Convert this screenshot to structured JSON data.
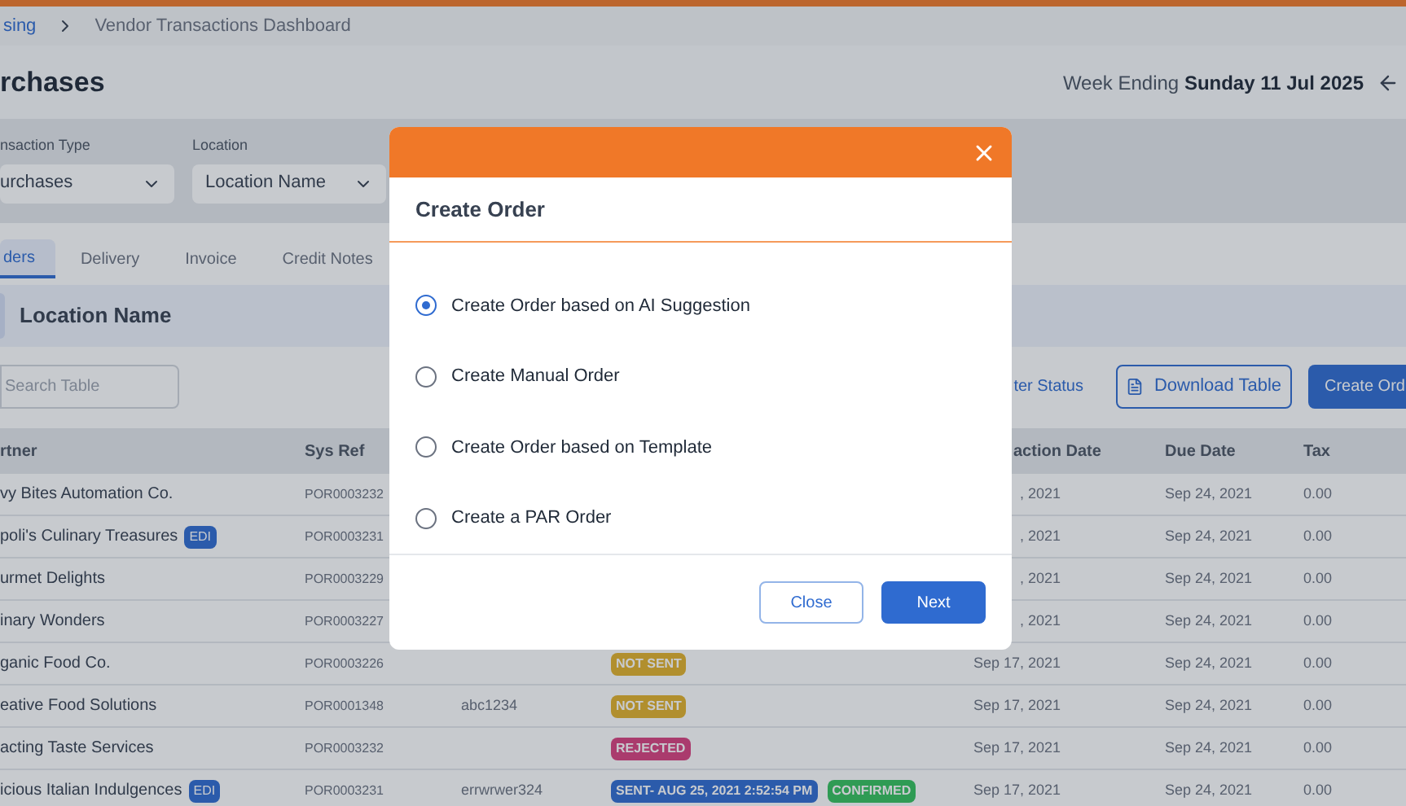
{
  "breadcrumb": [
    {
      "label": "sing",
      "link": true
    },
    {
      "label": "Vendor Transactions Dashboard",
      "link": false
    }
  ],
  "page_title": "rchases",
  "week": {
    "label": "Week Ending",
    "value": "Sunday 11 Jul 2025"
  },
  "filters": [
    {
      "label": "nsaction Type",
      "value": "urchases"
    },
    {
      "label": "Location",
      "value": "Location Name"
    }
  ],
  "tabs": [
    {
      "label": "ders",
      "selected": true
    },
    {
      "label": "Delivery",
      "selected": false
    },
    {
      "label": "Invoice",
      "selected": false
    },
    {
      "label": "Credit Notes",
      "selected": false
    }
  ],
  "location_bar": {
    "title": "Location Name"
  },
  "toolbar": {
    "search_placeholder": "Search Table",
    "filter_link": "ter Status",
    "download_button": "Download Table",
    "create_button": "Create Ord"
  },
  "table": {
    "columns": [
      "rtner",
      "Sys Ref",
      "action Date",
      "Due Date",
      "Tax"
    ],
    "rows": [
      {
        "partner": "vy Bites Automation Co.",
        "edi": null,
        "sys_ref": "POR0003232",
        "ref": null,
        "statuses": [],
        "transaction_date": ", 2021",
        "due_date": "Sep 24, 2021",
        "tax": "0.00"
      },
      {
        "partner": "poli's Culinary Treasures",
        "edi": "EDI",
        "sys_ref": "POR0003231",
        "ref": null,
        "statuses": [],
        "transaction_date": ", 2021",
        "due_date": "Sep 24, 2021",
        "tax": "0.00"
      },
      {
        "partner": "urmet Delights",
        "edi": null,
        "sys_ref": "POR0003229",
        "ref": null,
        "statuses": [],
        "transaction_date": ", 2021",
        "due_date": "Sep 24, 2021",
        "tax": "0.00"
      },
      {
        "partner": "inary Wonders",
        "edi": null,
        "sys_ref": "POR0003227",
        "ref": null,
        "statuses": [],
        "transaction_date": ", 2021",
        "due_date": "Sep 24, 2021",
        "tax": "0.00"
      },
      {
        "partner": "ganic Food Co.",
        "edi": null,
        "sys_ref": "POR0003226",
        "ref": null,
        "statuses": [
          {
            "label": "NOT SENT",
            "kind": "not_sent"
          }
        ],
        "transaction_date": "Sep 17, 2021",
        "due_date": "Sep 24, 2021",
        "tax": "0.00"
      },
      {
        "partner": "eative Food Solutions",
        "edi": null,
        "sys_ref": "POR0001348",
        "ref": "abc1234",
        "statuses": [
          {
            "label": "NOT SENT",
            "kind": "not_sent"
          }
        ],
        "transaction_date": "Sep 17, 2021",
        "due_date": "Sep 24, 2021",
        "tax": "0.00"
      },
      {
        "partner": "acting Taste Services",
        "edi": null,
        "sys_ref": "POR0003232",
        "ref": null,
        "statuses": [
          {
            "label": "REJECTED",
            "kind": "rejected"
          }
        ],
        "transaction_date": "Sep 17, 2021",
        "due_date": "Sep 24, 2021",
        "tax": "0.00"
      },
      {
        "partner": "icious Italian Indulgences",
        "edi": "EDI",
        "sys_ref": "POR0003231",
        "ref": "errwrwer324",
        "statuses": [
          {
            "label": "SENT- AUG 25, 2021 2:52:54 PM",
            "kind": "sent"
          },
          {
            "label": "CONFIRMED",
            "kind": "confirmed"
          }
        ],
        "transaction_date": "Sep 17, 2021",
        "due_date": "Sep 24, 2021",
        "tax": "0.00"
      }
    ]
  },
  "modal": {
    "title": "Create Order",
    "options": [
      {
        "label": "Create Order based on AI Suggestion",
        "selected": true
      },
      {
        "label": "Create Manual Order",
        "selected": false
      },
      {
        "label": "Create Order based on Template",
        "selected": false
      },
      {
        "label": "Create a PAR Order",
        "selected": false
      }
    ],
    "buttons": [
      {
        "label": "Close",
        "kind": "secondary"
      },
      {
        "label": "Next",
        "kind": "primary"
      }
    ]
  }
}
